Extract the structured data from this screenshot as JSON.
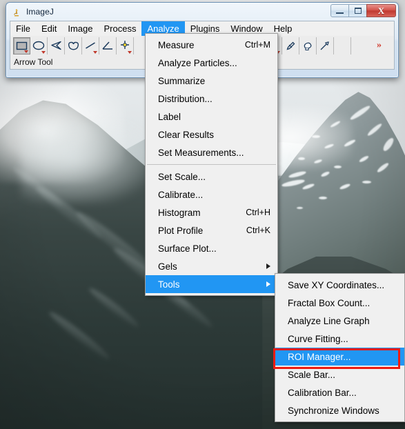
{
  "window": {
    "title": "ImageJ",
    "app_icon": "microscope-icon",
    "controls": {
      "minimize": "minimize-icon",
      "maximize": "maximize-icon",
      "close": "X"
    }
  },
  "menubar": {
    "items": [
      {
        "label": "File",
        "active": false
      },
      {
        "label": "Edit",
        "active": false
      },
      {
        "label": "Image",
        "active": false
      },
      {
        "label": "Process",
        "active": false
      },
      {
        "label": "Analyze",
        "active": true
      },
      {
        "label": "Plugins",
        "active": false
      },
      {
        "label": "Window",
        "active": false
      },
      {
        "label": "Help",
        "active": false
      }
    ]
  },
  "toolbar": {
    "tools": [
      {
        "name": "rectangle-tool",
        "selected": true,
        "dropdown": true
      },
      {
        "name": "oval-tool",
        "selected": false,
        "dropdown": true
      },
      {
        "name": "polygon-tool",
        "selected": false,
        "dropdown": false
      },
      {
        "name": "freehand-tool",
        "selected": false,
        "dropdown": false
      },
      {
        "name": "line-tool",
        "selected": false,
        "dropdown": true
      },
      {
        "name": "angle-tool",
        "selected": false,
        "dropdown": false
      },
      {
        "name": "point-tool",
        "selected": false,
        "dropdown": true
      }
    ],
    "tools_right": [
      {
        "name": "text-tool",
        "selected": false,
        "dropdown": true
      },
      {
        "name": "dropper-tool",
        "selected": false,
        "dropdown": false
      },
      {
        "name": "paintbrush-tool",
        "selected": false,
        "dropdown": false
      },
      {
        "name": "arrow-tool",
        "selected": false,
        "dropdown": false
      },
      {
        "name": "blank-slot-1",
        "selected": false,
        "dropdown": false
      },
      {
        "name": "blank-slot-2",
        "selected": false,
        "dropdown": false
      }
    ],
    "more_tools_label": "»"
  },
  "status": {
    "text": "Arrow Tool"
  },
  "analyze_menu": {
    "items": [
      {
        "label": "Analyze Particles...",
        "accel": "",
        "type": "item"
      },
      {
        "label": "Summarize",
        "accel": "",
        "type": "item"
      },
      {
        "label": "Distribution...",
        "accel": "",
        "type": "item"
      },
      {
        "label": "Label",
        "accel": "",
        "type": "item"
      },
      {
        "label": "Clear Results",
        "accel": "",
        "type": "item"
      },
      {
        "label": "Set Measurements...",
        "accel": "",
        "type": "item"
      }
    ],
    "first_item": {
      "label": "Measure",
      "accel": "Ctrl+M"
    },
    "group2": [
      {
        "label": "Set Scale...",
        "accel": ""
      },
      {
        "label": "Calibrate...",
        "accel": ""
      },
      {
        "label": "Histogram",
        "accel": "Ctrl+H"
      },
      {
        "label": "Plot Profile",
        "accel": "Ctrl+K"
      },
      {
        "label": "Surface Plot...",
        "accel": ""
      },
      {
        "label": "Gels",
        "accel": "",
        "submenu": true
      },
      {
        "label": "Tools",
        "accel": "",
        "submenu": true,
        "highlighted": true
      }
    ]
  },
  "tools_submenu": {
    "items": [
      {
        "label": "Save XY Coordinates...",
        "highlighted": false
      },
      {
        "label": "Fractal Box Count...",
        "highlighted": false
      },
      {
        "label": "Analyze Line Graph",
        "highlighted": false
      },
      {
        "label": "Curve Fitting...",
        "highlighted": false
      },
      {
        "label": "ROI Manager...",
        "highlighted": true
      },
      {
        "label": "Scale Bar...",
        "highlighted": false
      },
      {
        "label": "Calibration Bar...",
        "highlighted": false
      },
      {
        "label": "Synchronize Windows",
        "highlighted": false
      }
    ]
  },
  "annotation": {
    "highlight_target": "ROI Manager...",
    "highlight_color": "#ee1b11"
  },
  "colors": {
    "menu_highlight": "#2196f3",
    "menu_bg": "#f0f0f0",
    "window_chrome": "#d2e1f0",
    "close_button": "#bf3a31"
  },
  "background": {
    "description": "mountain-landscape-photo"
  }
}
